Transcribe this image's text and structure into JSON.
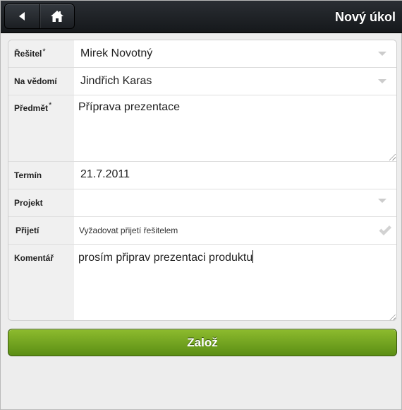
{
  "header": {
    "title": "Nový úkol",
    "back_icon": "back-arrow-icon",
    "home_icon": "home-icon"
  },
  "form": {
    "resitel": {
      "label": "Řešitel",
      "required": "*",
      "value": "Mirek Novotný"
    },
    "na_vedomi": {
      "label": "Na vědomí",
      "value": "Jindřich Karas"
    },
    "predmet": {
      "label": "Předmět",
      "required": "*",
      "value": "Příprava prezentace"
    },
    "termin": {
      "label": "Termín",
      "value": "21.7.2011"
    },
    "projekt": {
      "label": "Projekt",
      "value": ""
    },
    "prijeti": {
      "label": "Přijetí",
      "value": "Vyžadovat přijetí řešitelem",
      "checked": true
    },
    "komentar": {
      "label": "Komentář",
      "value": "prosím připrav prezentaci produktu"
    }
  },
  "submit_label": "Založ",
  "colors": {
    "header_bg": "#1e2226",
    "submit_green": "#6fa01f",
    "label_bg": "#f0f0f0"
  }
}
